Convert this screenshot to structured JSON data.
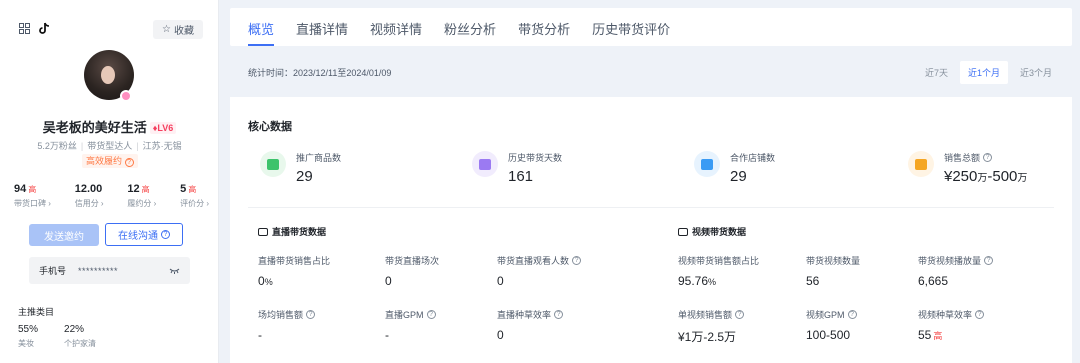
{
  "profile": {
    "favorite_label": "收藏",
    "name": "吴老板的美好生活",
    "level": "LV6",
    "fans": "5.2万粉丝",
    "type": "带货型达人",
    "location": "江苏·无锡",
    "tag": "高效履约",
    "stats": [
      {
        "value": "94",
        "high": "高",
        "label": "带货口碑"
      },
      {
        "value": "12.00",
        "high": "",
        "label": "信用分"
      },
      {
        "value": "12",
        "high": "高",
        "label": "履约分"
      },
      {
        "value": "5",
        "high": "高",
        "label": "评价分"
      }
    ],
    "invite_label": "发送邀约",
    "chat_label": "在线沟通",
    "phone_label": "手机号",
    "phone_value": "**********",
    "category_title": "主推类目",
    "categories": [
      {
        "percent": "55%",
        "name": "美妆"
      },
      {
        "percent": "22%",
        "name": "个护家清"
      }
    ]
  },
  "tabs": [
    "概览",
    "直播详情",
    "视频详情",
    "粉丝分析",
    "带货分析",
    "历史带货评价"
  ],
  "period": {
    "text": "统计时间：2023/12/11至2024/01/09",
    "ranges": [
      "近7天",
      "近1个月",
      "近3个月"
    ]
  },
  "core": {
    "title": "核心数据",
    "kpis": [
      {
        "label": "推广商品数",
        "value": "29",
        "unit": "",
        "value2": "",
        "unit2": ""
      },
      {
        "label": "历史带货天数",
        "value": "161",
        "unit": "",
        "value2": "",
        "unit2": ""
      },
      {
        "label": "合作店铺数",
        "value": "29",
        "unit": "",
        "value2": "",
        "unit2": ""
      },
      {
        "label": "销售总额",
        "value": "¥250",
        "unit": "万",
        "value2": "-500",
        "unit2": "万"
      }
    ]
  },
  "live": {
    "title": "直播带货数据",
    "metrics": [
      {
        "label": "直播带货销售占比",
        "value": "0",
        "unit": "%",
        "hi": ""
      },
      {
        "label": "带货直播场次",
        "value": "0",
        "unit": "",
        "hi": ""
      },
      {
        "label": "带货直播观看人数",
        "value": "0",
        "unit": "",
        "hi": ""
      },
      {
        "label": "场均销售额",
        "value": "-",
        "unit": "",
        "hi": ""
      },
      {
        "label": "直播GPM",
        "value": "-",
        "unit": "",
        "hi": ""
      },
      {
        "label": "直播种草效率",
        "value": "0",
        "unit": "",
        "hi": ""
      }
    ]
  },
  "video": {
    "title": "视频带货数据",
    "metrics": [
      {
        "label": "视频带货销售额占比",
        "value": "95.76",
        "unit": "%",
        "hi": ""
      },
      {
        "label": "带货视频数量",
        "value": "56",
        "unit": "",
        "hi": ""
      },
      {
        "label": "带货视频播放量",
        "value": "6,665",
        "unit": "",
        "hi": ""
      },
      {
        "label": "单视频销售额",
        "value": "¥1万-2.5万",
        "unit": "",
        "hi": ""
      },
      {
        "label": "视频GPM",
        "value": "100-500",
        "unit": "",
        "hi": ""
      },
      {
        "label": "视频种草效率",
        "value": "55",
        "unit": "",
        "hi": "高"
      }
    ]
  },
  "colors": {
    "accent": "#3d6ff4",
    "high": "#f53f3f",
    "tag": "#ff7a45"
  }
}
